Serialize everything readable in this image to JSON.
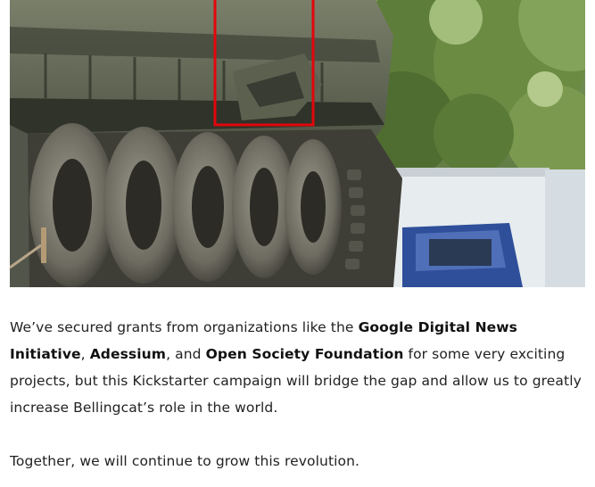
{
  "article": {
    "image": {
      "annotation_color": "#e2060b"
    },
    "paragraph_1": {
      "text_1": "We’ve secured grants from organizations like the ",
      "org_1": "Google Digital News Initiative",
      "sep_1": ", ",
      "org_2": "Adessium",
      "sep_2": ", and ",
      "org_3": "Open Society Foundation",
      "text_2": " for some very exciting projects, but this Kickstarter campaign will bridge the gap and allow us to greatly increase Bellingcat’s role in the world."
    },
    "paragraph_2": {
      "text": "Together, we will continue to grow this revolution."
    }
  }
}
